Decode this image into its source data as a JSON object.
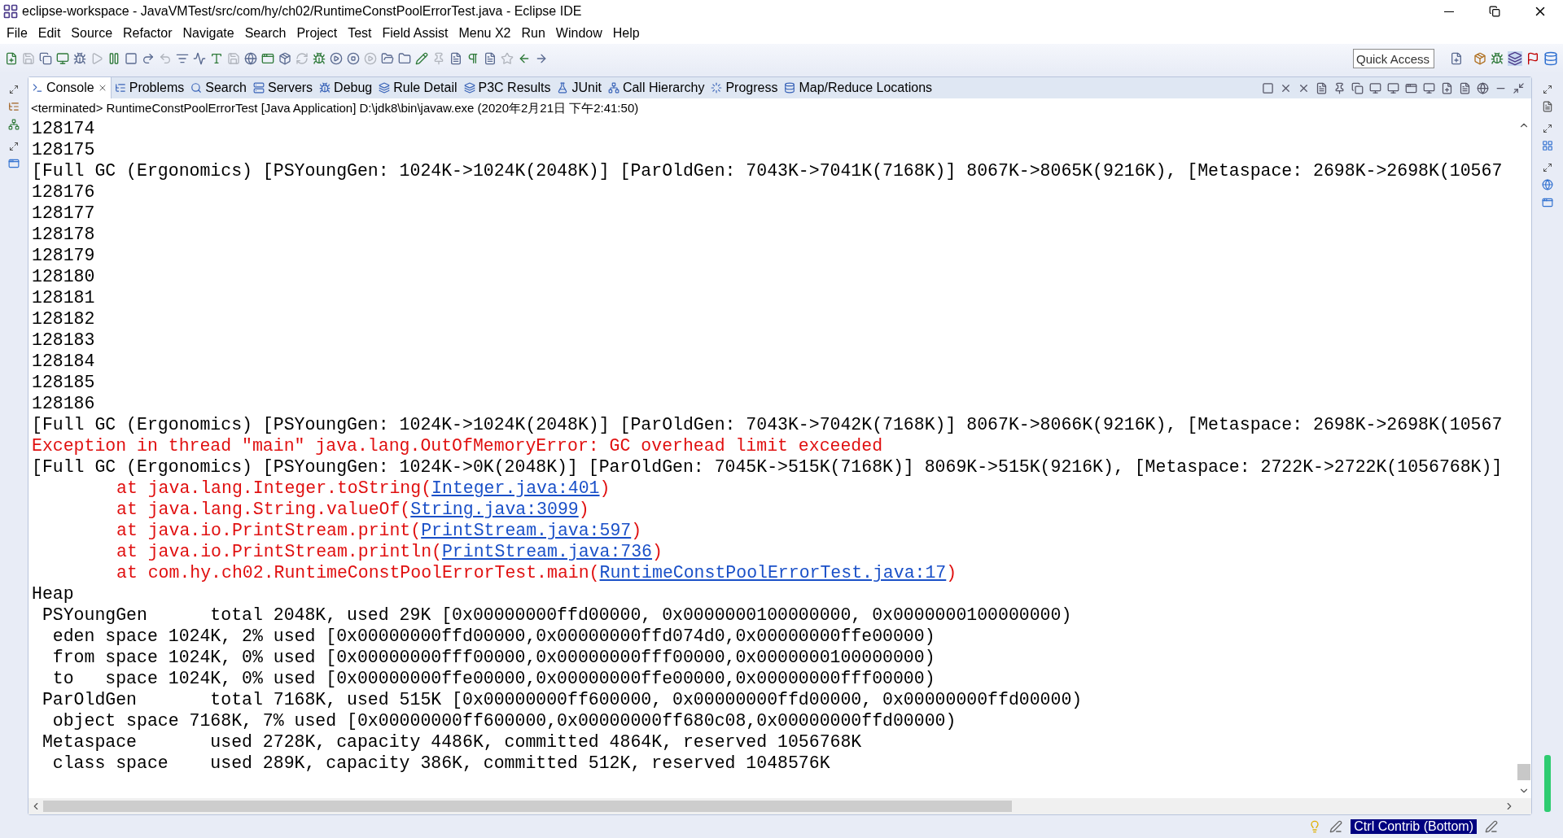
{
  "window": {
    "title": "eclipse-workspace - JavaVMTest/src/com/hy/ch02/RuntimeConstPoolErrorTest.java - Eclipse IDE"
  },
  "menu": [
    "File",
    "Edit",
    "Source",
    "Refactor",
    "Navigate",
    "Search",
    "Project",
    "Test",
    "Field Assist",
    "Menu X2",
    "Run",
    "Window",
    "Help"
  ],
  "quick_access": {
    "placeholder": "Quick Access"
  },
  "tabs": [
    {
      "label": "Console",
      "selected": true
    },
    {
      "label": "Problems",
      "selected": false
    },
    {
      "label": "Search",
      "selected": false
    },
    {
      "label": "Servers",
      "selected": false
    },
    {
      "label": "Debug",
      "selected": false
    },
    {
      "label": "Rule Detail",
      "selected": false
    },
    {
      "label": "P3C Results",
      "selected": false
    },
    {
      "label": "JUnit",
      "selected": false
    },
    {
      "label": "Call Hierarchy",
      "selected": false
    },
    {
      "label": "Progress",
      "selected": false
    },
    {
      "label": "Map/Reduce Locations",
      "selected": false
    }
  ],
  "console": {
    "header": "<terminated> RuntimeConstPoolErrorTest [Java Application] D:\\jdk8\\bin\\javaw.exe (2020年2月21日 下午2:41:50)",
    "lines": [
      {
        "kind": "out",
        "text": "128174"
      },
      {
        "kind": "out",
        "text": "128175"
      },
      {
        "kind": "out",
        "text": "[Full GC (Ergonomics) [PSYoungGen: 1024K->1024K(2048K)] [ParOldGen: 7043K->7041K(7168K)] 8067K->8065K(9216K), [Metaspace: 2698K->2698K(10567"
      },
      {
        "kind": "out",
        "text": "128176"
      },
      {
        "kind": "out",
        "text": "128177"
      },
      {
        "kind": "out",
        "text": "128178"
      },
      {
        "kind": "out",
        "text": "128179"
      },
      {
        "kind": "out",
        "text": "128180"
      },
      {
        "kind": "out",
        "text": "128181"
      },
      {
        "kind": "out",
        "text": "128182"
      },
      {
        "kind": "out",
        "text": "128183"
      },
      {
        "kind": "out",
        "text": "128184"
      },
      {
        "kind": "out",
        "text": "128185"
      },
      {
        "kind": "out",
        "text": "128186"
      },
      {
        "kind": "out",
        "text": "[Full GC (Ergonomics) [PSYoungGen: 1024K->1024K(2048K)] [ParOldGen: 7043K->7042K(7168K)] 8067K->8066K(9216K), [Metaspace: 2698K->2698K(10567"
      },
      {
        "kind": "err",
        "text": "Exception in thread \"main\" java.lang.OutOfMemoryError: GC overhead limit exceeded"
      },
      {
        "kind": "out",
        "text": "[Full GC (Ergonomics) [PSYoungGen: 1024K->0K(2048K)] [ParOldGen: 7045K->515K(7168K)] 8069K->515K(9216K), [Metaspace: 2722K->2722K(1056768K)]"
      },
      {
        "kind": "trace",
        "text": "at java.lang.Integer.toString(",
        "link": "Integer.java:401",
        "end": ")"
      },
      {
        "kind": "trace",
        "text": "at java.lang.String.valueOf(",
        "link": "String.java:3099",
        "end": ")"
      },
      {
        "kind": "trace",
        "text": "at java.io.PrintStream.print(",
        "link": "PrintStream.java:597",
        "end": ")"
      },
      {
        "kind": "trace",
        "text": "at java.io.PrintStream.println(",
        "link": "PrintStream.java:736",
        "end": ")"
      },
      {
        "kind": "trace",
        "text": "at com.hy.ch02.RuntimeConstPoolErrorTest.main(",
        "link": "RuntimeConstPoolErrorTest.java:17",
        "end": ")"
      },
      {
        "kind": "out",
        "text": "Heap"
      },
      {
        "kind": "out",
        "text": " PSYoungGen      total 2048K, used 29K [0x00000000ffd00000, 0x0000000100000000, 0x0000000100000000)"
      },
      {
        "kind": "out",
        "text": "  eden space 1024K, 2% used [0x00000000ffd00000,0x00000000ffd074d0,0x00000000ffe00000)"
      },
      {
        "kind": "out",
        "text": "  from space 1024K, 0% used [0x00000000fff00000,0x00000000fff00000,0x0000000100000000)"
      },
      {
        "kind": "out",
        "text": "  to   space 1024K, 0% used [0x00000000ffe00000,0x00000000ffe00000,0x00000000fff00000)"
      },
      {
        "kind": "out",
        "text": " ParOldGen       total 7168K, used 515K [0x00000000ff600000, 0x00000000ffd00000, 0x00000000ffd00000)"
      },
      {
        "kind": "out",
        "text": "  object space 7168K, 7% used [0x00000000ff600000,0x00000000ff680c08,0x00000000ffd00000)"
      },
      {
        "kind": "out",
        "text": " Metaspace       used 2728K, capacity 4486K, committed 4864K, reserved 1056768K"
      },
      {
        "kind": "out",
        "text": "  class space    used 289K, capacity 386K, committed 512K, reserved 1048576K"
      }
    ]
  },
  "status_bar": {
    "label": "Ctrl Contrib (Bottom)"
  }
}
